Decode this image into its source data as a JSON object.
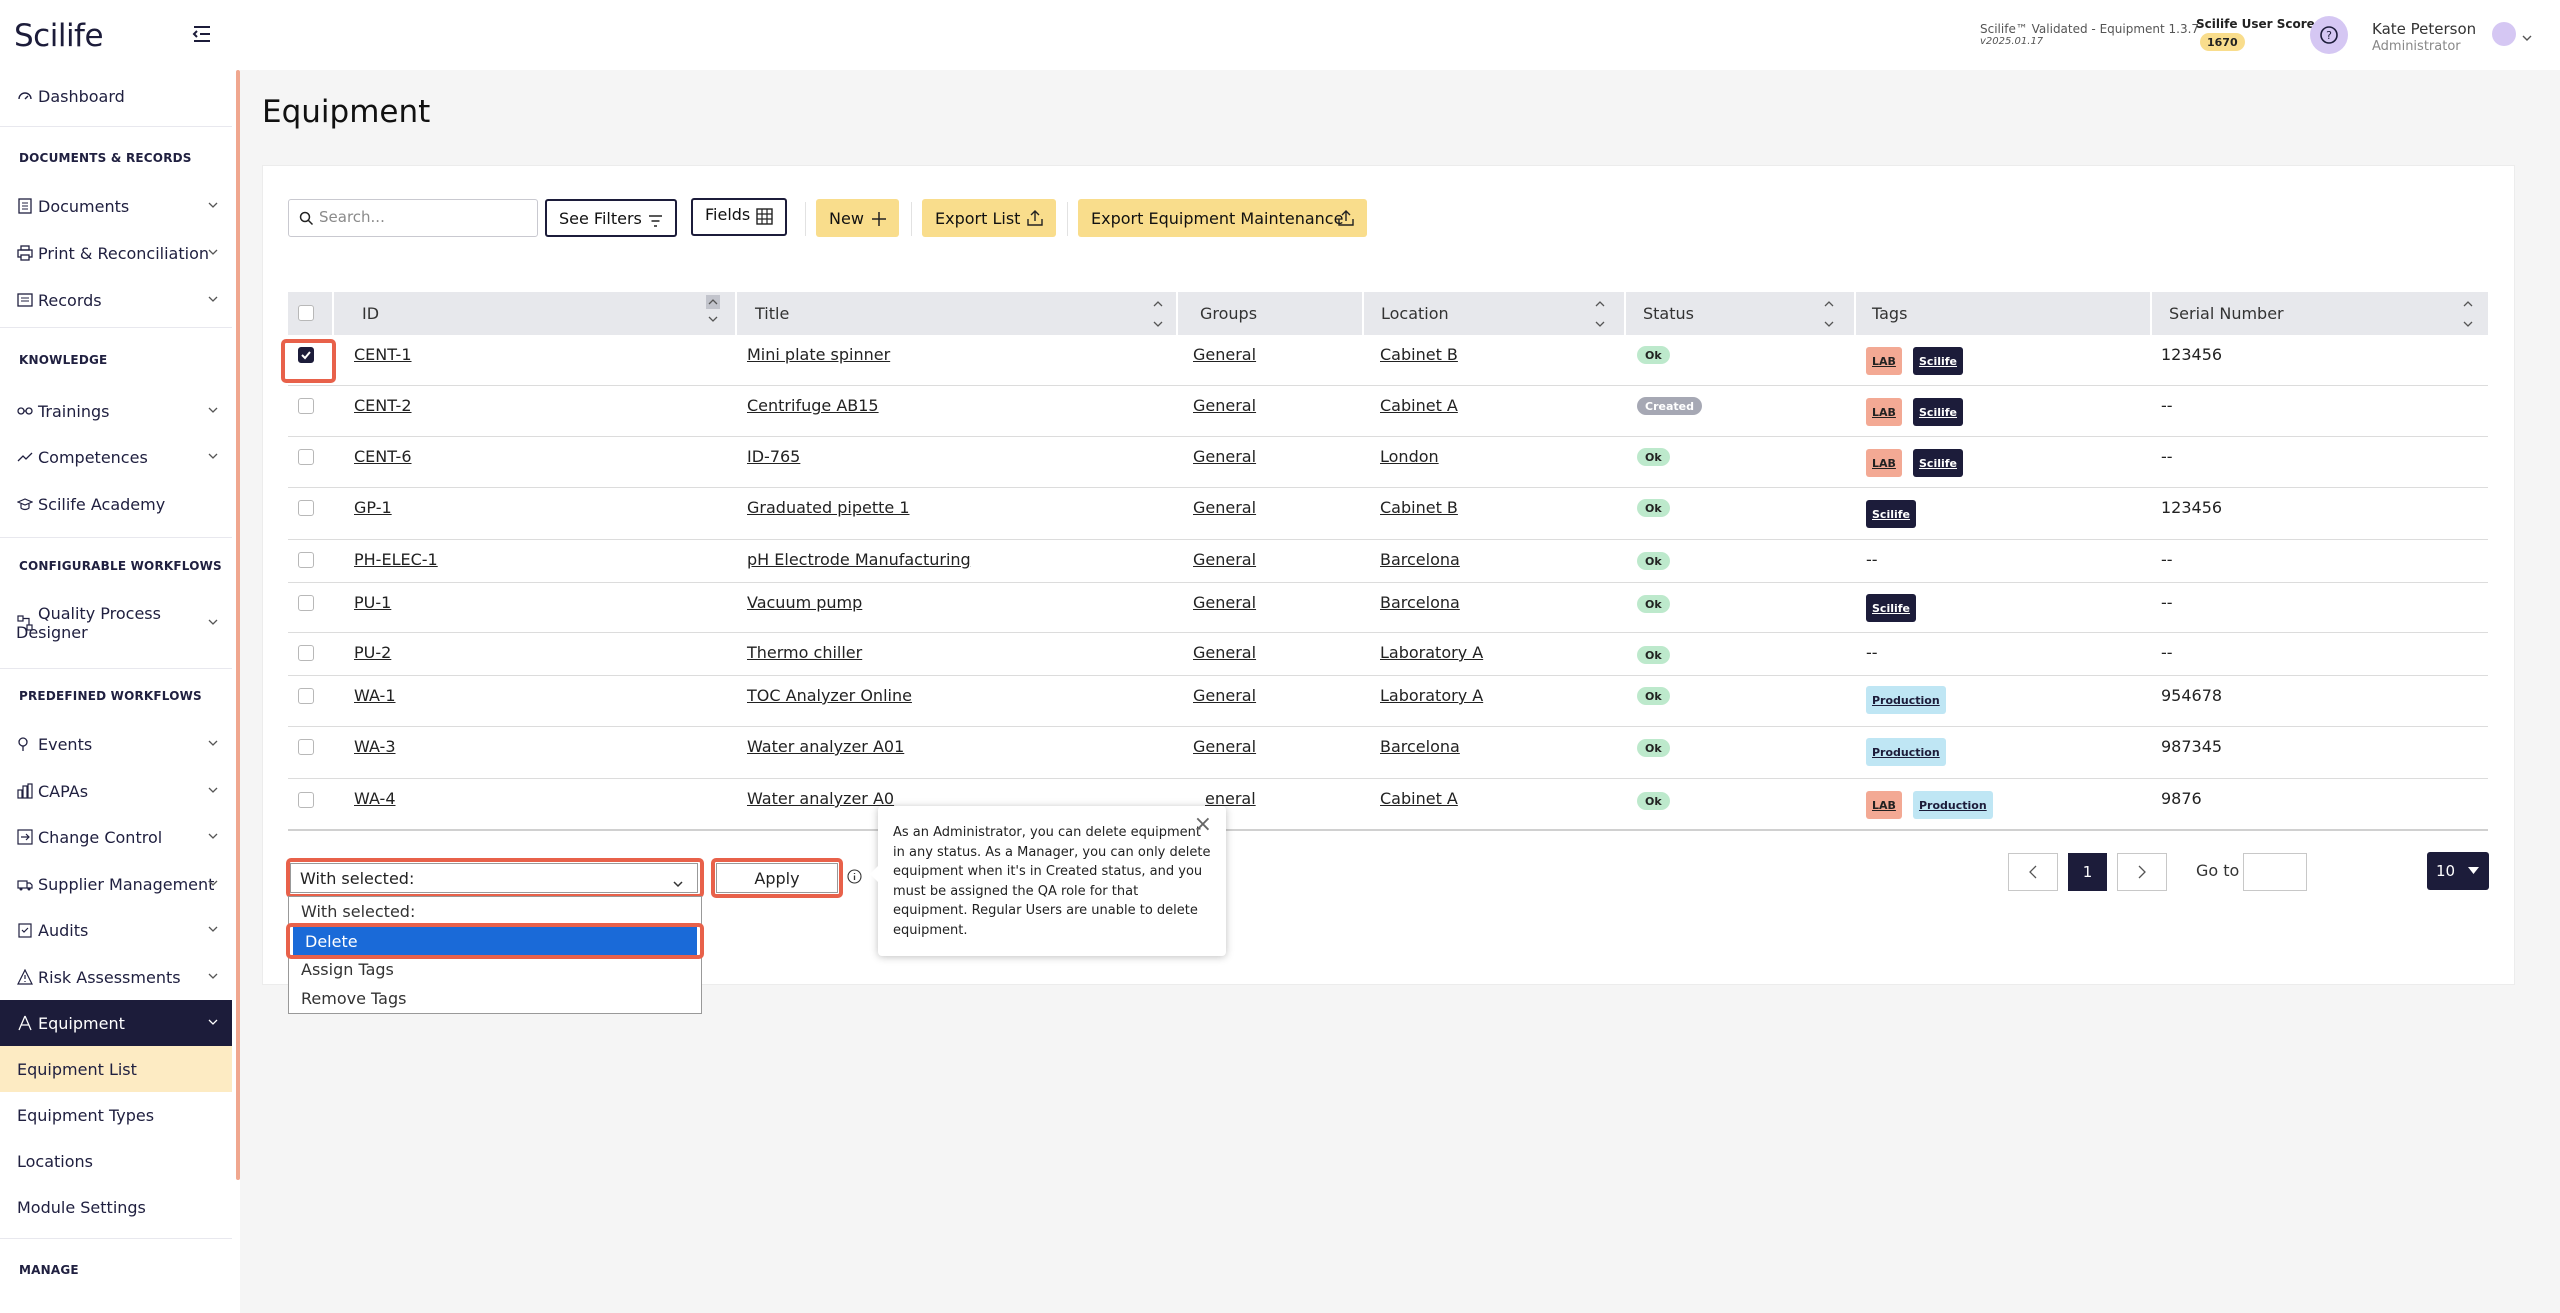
{
  "app": {
    "logo": "Scilife",
    "version_label": "Scilife™ Validated - Equipment 1.3.7",
    "version_date": "v2025.01.17",
    "user_score_label": "Scilife User Score",
    "user_score_value": "1670",
    "help_icon": "question-circle-icon",
    "user_name": "Kate Peterson",
    "user_role": "Administrator"
  },
  "sidebar": {
    "dashboard": "Dashboard",
    "section_docs": "DOCUMENTS & RECORDS",
    "documents": "Documents",
    "print": "Print & Reconciliation",
    "records": "Records",
    "section_knowledge": "KNOWLEDGE",
    "trainings": "Trainings",
    "competences": "Competences",
    "academy": "Scilife Academy",
    "section_config": "CONFIGURABLE WORKFLOWS",
    "qpd_line1": "Quality Process",
    "qpd_line2": "Designer",
    "section_predef": "PREDEFINED WORKFLOWS",
    "events": "Events",
    "capas": "CAPAs",
    "change_control": "Change Control",
    "supplier": "Supplier Management",
    "audits": "Audits",
    "risk": "Risk Assessments",
    "equipment": "Equipment",
    "equipment_list": "Equipment List",
    "equipment_types": "Equipment Types",
    "locations": "Locations",
    "module_settings": "Module Settings",
    "section_manage": "MANAGE"
  },
  "page": {
    "title": "Equipment"
  },
  "toolbar": {
    "search_placeholder": "Search...",
    "see_filters": "See Filters",
    "fields": "Fields",
    "new": "New",
    "export_list": "Export List",
    "export_maintenance": "Export Equipment Maintenance"
  },
  "table": {
    "headers": {
      "id": "ID",
      "title": "Title",
      "groups": "Groups",
      "location": "Location",
      "status": "Status",
      "tags": "Tags",
      "serial": "Serial Number"
    },
    "rows": [
      {
        "id": "CENT-1",
        "title": "Mini plate spinner",
        "group": "General",
        "location": "Cabinet B",
        "status": "Ok",
        "serial": "123456",
        "checked": true
      },
      {
        "id": "CENT-2",
        "title": "Centrifuge AB15",
        "group": "General",
        "location": "Cabinet A",
        "status": "Created",
        "serial": "--"
      },
      {
        "id": "CENT-6",
        "title": "ID-765",
        "group": "General",
        "location": "London",
        "status": "Ok",
        "serial": "--"
      },
      {
        "id": "GP-1",
        "title": "Graduated pipette 1",
        "group": "General",
        "location": "Cabinet B",
        "status": "Ok",
        "serial": "123456"
      },
      {
        "id": "PH-ELEC-1",
        "title": "pH Electrode Manufacturing",
        "group": "General",
        "location": "Barcelona",
        "status": "Ok",
        "tags_text": "--",
        "serial": "--"
      },
      {
        "id": "PU-1",
        "title": "Vacuum pump",
        "group": "General",
        "location": "Barcelona",
        "status": "Ok",
        "serial": "--"
      },
      {
        "id": "PU-2",
        "title": "Thermo chiller",
        "group": "General",
        "location": "Laboratory A",
        "status": "Ok",
        "tags_text": "--",
        "serial": "--"
      },
      {
        "id": "WA-1",
        "title": "TOC Analyzer Online",
        "group": "General",
        "location": "Laboratory A",
        "status": "Ok",
        "serial": "954678"
      },
      {
        "id": "WA-3",
        "title": "Water analyzer A01",
        "group": "General",
        "location": "Barcelona",
        "status": "Ok",
        "serial": "987345"
      },
      {
        "id": "WA-4",
        "title": "Water analyzer A0",
        "group": "eneral",
        "location": "Cabinet A",
        "status": "Ok",
        "serial": "9876"
      }
    ],
    "tags": {
      "lab": "LAB",
      "scilife": "Scilife",
      "production": "Production"
    }
  },
  "bulk": {
    "select_value": "With selected:",
    "options": [
      "With selected:",
      "Delete",
      "Assign Tags",
      "Remove Tags"
    ],
    "apply": "Apply",
    "tooltip": "As an Administrator, you can delete equipment in any status. As a Manager, you can only delete equipment when it's in Created status, and you must be assigned the QA role for that equipment. Regular Users are unable to delete equipment."
  },
  "pagination": {
    "current": "1",
    "goto_label": "Go to",
    "page_size": "10"
  },
  "colors": {
    "navy": "#1c1c3a",
    "yellow": "#f9dd8c",
    "highlight": "#e8614a",
    "select_blue": "#1a6ad8"
  }
}
